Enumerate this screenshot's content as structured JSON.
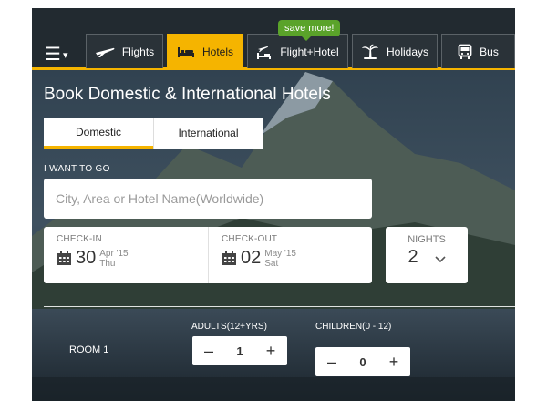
{
  "nav": {
    "tabs": [
      {
        "label": "Flights",
        "icon": "plane-icon"
      },
      {
        "label": "Hotels",
        "icon": "bed-icon",
        "active": true
      },
      {
        "label": "Flight+Hotel",
        "icon": "flight-hotel-icon"
      },
      {
        "label": "Holidays",
        "icon": "palm-tree-icon"
      },
      {
        "label": "Bus",
        "icon": "bus-icon"
      }
    ],
    "badge": "save more!"
  },
  "form": {
    "title": "Book Domestic & International Hotels",
    "segments": [
      {
        "label": "Domestic",
        "active": true
      },
      {
        "label": "International"
      }
    ],
    "destination": {
      "label": "I WANT TO GO",
      "placeholder": "City, Area or Hotel Name(Worldwide)",
      "value": ""
    },
    "checkin": {
      "label": "CHECK-IN",
      "day": "30",
      "month_year": "Apr '15",
      "weekday": "Thu"
    },
    "checkout": {
      "label": "CHECK-OUT",
      "day": "02",
      "month_year": "May '15",
      "weekday": "Sat"
    },
    "nights": {
      "label": "NIGHTS",
      "value": "2"
    },
    "room": {
      "label": "ROOM 1",
      "adults_label": "ADULTS(12+YRS)",
      "adults": "1",
      "children_label": "CHILDREN(0 - 12)",
      "children": "0",
      "minus": "–",
      "plus": "+"
    }
  },
  "colors": {
    "accent": "#f5b400",
    "badge": "#5aa32a",
    "topbar": "#222a30"
  }
}
